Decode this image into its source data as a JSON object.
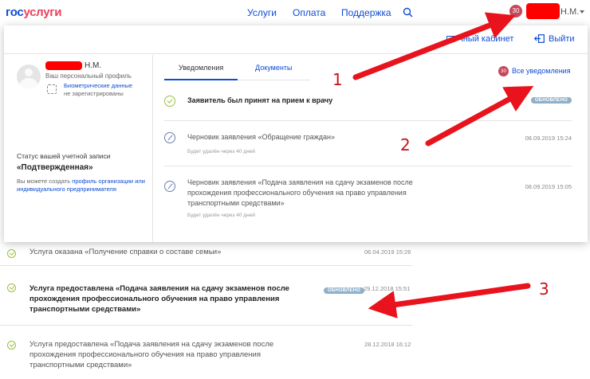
{
  "header": {
    "logo_part1": "гос",
    "logo_part2": "услуги",
    "nav": [
      "Услуги",
      "Оплата",
      "Поддержка"
    ],
    "notification_count": "30",
    "user_initials": "Н.М."
  },
  "panel": {
    "cabinet_label": "чный кабинет",
    "logout_label": "Выйти",
    "profile": {
      "initials": "Н.М.",
      "subtitle": "Ваш персональный профиль",
      "biometrics_link": "Биометрические данные",
      "biometrics_note": "не зарегистрированы",
      "account_status_label": "Статус вашей учетной записи",
      "account_status": "«Подтвержденная»",
      "note_prefix": "Вы можете создать ",
      "note_link": "профиль организации или индивидуального предпринимателя"
    },
    "tabs": [
      "Уведомления",
      "Документы"
    ],
    "all_count": "30",
    "all_label": "Все уведомления",
    "notifications": [
      {
        "title": "Заявитель был принят на прием к врачу",
        "badge": "ОБНОВЛЕНО",
        "date": "",
        "sub": ""
      },
      {
        "title": "Черновик заявления «Обращение граждан»",
        "badge": "",
        "date": "08.09.2019 15:24",
        "sub": "Будет удалён через 40 дней"
      },
      {
        "title_lines": [
          "Черновик заявления «Подача заявления на сдачу экзаменов после",
          "прохождения профессионального обучения на право управления",
          "транспортными средствами»"
        ],
        "date": "08.09.2019 15:05",
        "sub": "Будет удалён через 40 дней"
      }
    ]
  },
  "background_list": [
    {
      "title": "Услуга оказана «Получение справки о составе семьи»",
      "date": "06.04.2019 15:26"
    },
    {
      "title_lines": [
        "Услуга предоставлена «Подача заявления на сдачу экзаменов после",
        "прохождения профессионального обучения на право управления",
        "транспортными средствами»"
      ],
      "badge": "ОБНОВЛЕНО",
      "date": "29.12.2018 15:51"
    },
    {
      "title_lines": [
        "Услуга предоставлена «Подача заявления на сдачу экзаменов после",
        "прохождения профессионального обучения на право управления",
        "транспортными средствами»"
      ],
      "date": "28.12.2018 16:12"
    }
  ],
  "annotations": [
    "1",
    "2",
    "3"
  ],
  "colors": {
    "accent": "#0d4cd3",
    "brand_red": "#ee3f58",
    "badge": "#c7475a",
    "check": "#9abf3c",
    "arrow": "#e8131c"
  }
}
